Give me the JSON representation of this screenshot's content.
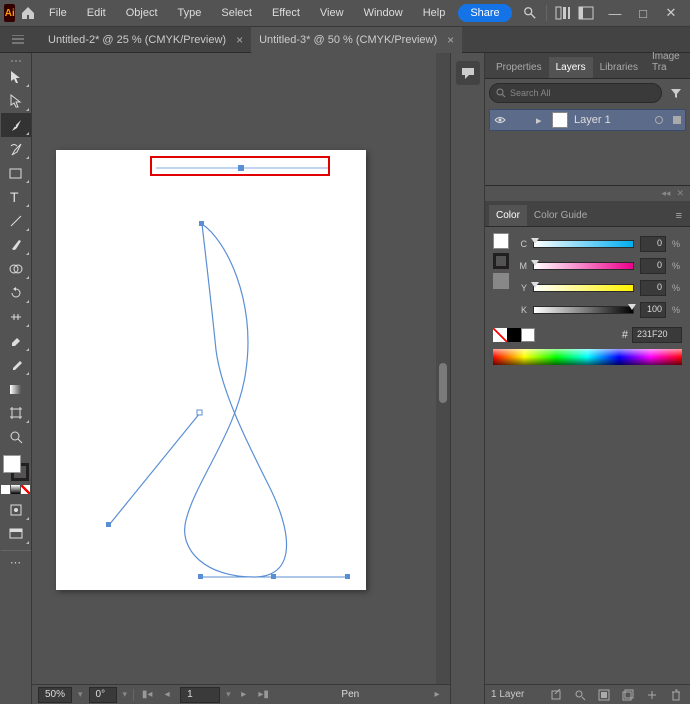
{
  "menu": {
    "file": "File",
    "edit": "Edit",
    "object": "Object",
    "type": "Type",
    "select": "Select",
    "effect": "Effect",
    "view": "View",
    "window": "Window",
    "help": "Help"
  },
  "share": "Share",
  "tabs": [
    {
      "label": "Untitled-2* @ 25 % (CMYK/Preview)",
      "active": false
    },
    {
      "label": "Untitled-3* @ 50 % (CMYK/Preview)",
      "active": true
    }
  ],
  "status": {
    "zoom": "50%",
    "rotate": "0°",
    "artboard": "1",
    "tool": "Pen"
  },
  "panels": {
    "top": {
      "properties": "Properties",
      "layers": "Layers",
      "libraries": "Libraries",
      "imagetrace": "Image Tra"
    },
    "search_placeholder": "Search All",
    "layer": {
      "name": "Layer 1"
    },
    "color": {
      "tab": "Color",
      "guide": "Color Guide",
      "c_label": "C",
      "m_label": "M",
      "y_label": "Y",
      "k_label": "K",
      "c": "0",
      "m": "0",
      "y": "0",
      "k": "100",
      "pct": "%",
      "hex": "231F20",
      "hash": "#"
    },
    "footer": "1 Layer"
  },
  "colors": {
    "panel_bg": "#535353",
    "accent": "#1473e6",
    "stroke": "#221f20"
  }
}
